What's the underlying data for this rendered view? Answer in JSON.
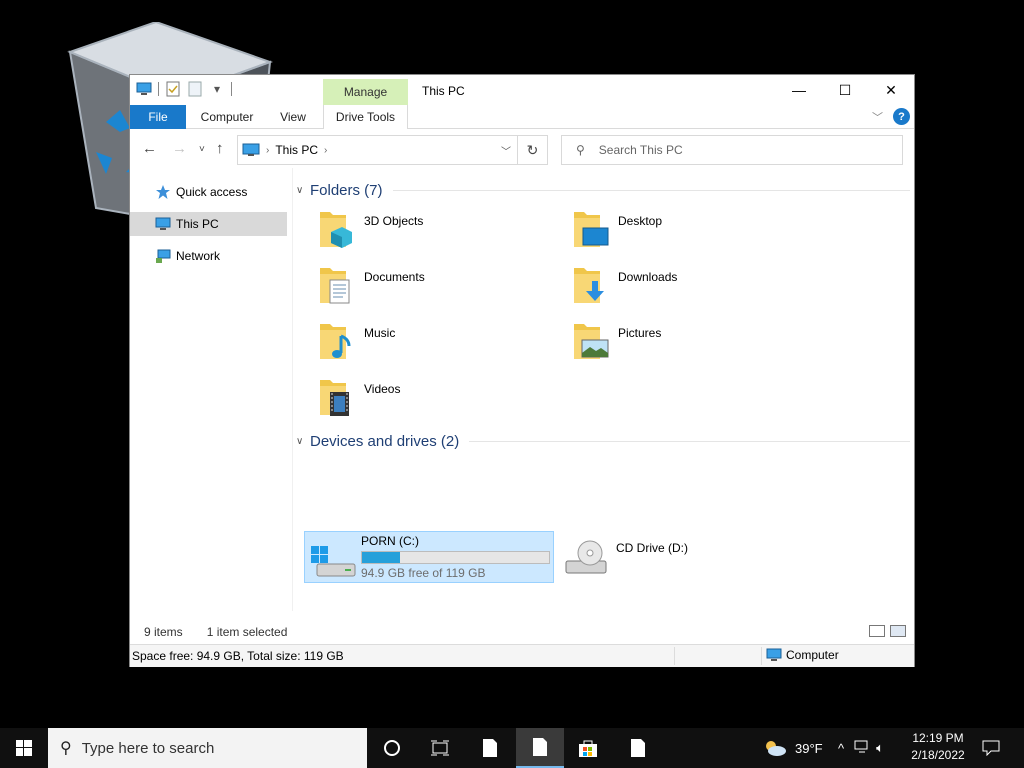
{
  "window": {
    "title": "This PC",
    "contextual_tab_group": "Manage",
    "controls": {
      "minimize": "—",
      "maximize": "☐",
      "close": "✕"
    }
  },
  "ribbon": {
    "tabs": [
      {
        "label": "File"
      },
      {
        "label": "Computer"
      },
      {
        "label": "View"
      },
      {
        "label": "Drive Tools"
      }
    ],
    "help": "?"
  },
  "address_bar": {
    "crumbs": [
      "This PC"
    ],
    "refresh_icon": "refresh-icon"
  },
  "search": {
    "placeholder": "Search This PC"
  },
  "nav_pane": {
    "items": [
      {
        "label": "Quick access",
        "icon": "star-icon",
        "selected": false
      },
      {
        "label": "This PC",
        "icon": "computer-icon",
        "selected": true
      },
      {
        "label": "Network",
        "icon": "network-icon",
        "selected": false
      }
    ]
  },
  "content": {
    "folders_header": "Folders (7)",
    "folders": [
      {
        "label": "3D Objects",
        "icon": "3d-objects-folder-icon"
      },
      {
        "label": "Desktop",
        "icon": "desktop-folder-icon"
      },
      {
        "label": "Documents",
        "icon": "documents-folder-icon"
      },
      {
        "label": "Downloads",
        "icon": "downloads-folder-icon"
      },
      {
        "label": "Music",
        "icon": "music-folder-icon"
      },
      {
        "label": "Pictures",
        "icon": "pictures-folder-icon"
      },
      {
        "label": "Videos",
        "icon": "videos-folder-icon"
      }
    ],
    "drives_header": "Devices and drives (2)",
    "drives": [
      {
        "label": "PORN (C:)",
        "space": "94.9 GB free of 119 GB",
        "used_fraction": 0.203,
        "selected": true,
        "icon": "local-disk-icon"
      },
      {
        "label": "CD Drive (D:)",
        "icon": "cd-drive-icon"
      }
    ]
  },
  "status": {
    "items": "9 items",
    "selected": "1 item selected"
  },
  "details_bar": {
    "text": "Space free: 94.9 GB, Total size: 119 GB",
    "location": "Computer"
  },
  "taskbar": {
    "search_placeholder": "Type here to search",
    "weather": "39°F",
    "time": "12:19 PM",
    "date": "2/18/2022"
  },
  "colors": {
    "accent": "#1979ca",
    "manage_tab": "#d6f0b8",
    "selection": "#cce8ff",
    "progress": "#26a0da"
  }
}
